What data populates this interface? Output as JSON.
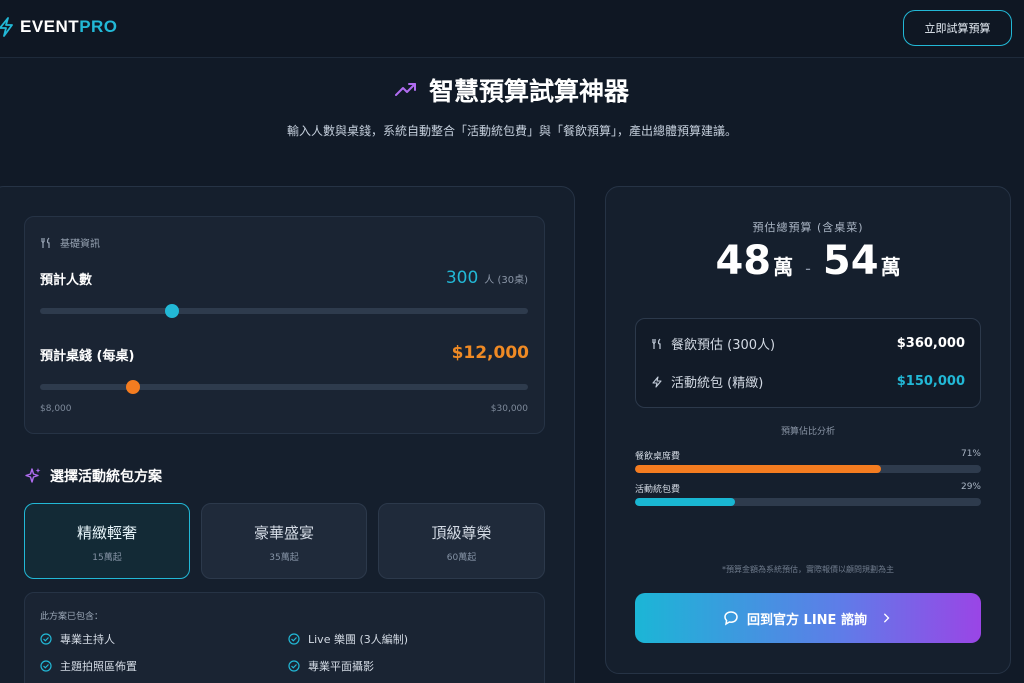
{
  "header": {
    "brand_a": "EVENT",
    "brand_b": "PRO",
    "cta": "立即試算預算"
  },
  "hero": {
    "title": "智慧預算試算神器",
    "subtitle": "輸入人數與桌錢，系統自動整合「活動統包費」與「餐飲預算」，產出總體預算建議。"
  },
  "basic": {
    "section_label": "基礎資訊",
    "people_label": "預計人數",
    "people_value": "300",
    "people_unit": "人 (30桌)",
    "people_slider_fraction": 0.27,
    "price_label": "預計桌錢 (每桌)",
    "price_value": "$12,000",
    "price_slider_fraction": 0.19,
    "price_min": "$8,000",
    "price_max": "$30,000"
  },
  "packages": {
    "heading": "選擇活動統包方案",
    "items": [
      {
        "name": "精緻輕奢",
        "sub": "15萬起",
        "active": true
      },
      {
        "name": "豪華盛宴",
        "sub": "35萬起",
        "active": false
      },
      {
        "name": "頂級尊榮",
        "sub": "60萬起",
        "active": false
      }
    ]
  },
  "includes": {
    "title": "此方案已包含：",
    "items": [
      "專業主持人",
      "Live 樂團 (3人編制)",
      "主題拍照區佈置",
      "專業平面攝影"
    ]
  },
  "estimate": {
    "label": "預估總預算 (含桌菜)",
    "low": "48",
    "high": "54",
    "unit": "萬",
    "dash": "-",
    "catering_label": "餐飲預估 (300人)",
    "catering_value": "$360,000",
    "package_label": "活動統包 (精緻)",
    "package_value": "$150,000",
    "ratio_title": "預算佔比分析",
    "bars": [
      {
        "label": "餐飲桌席費",
        "pct": "71%",
        "fraction": 0.71,
        "color": "#f47c20"
      },
      {
        "label": "活動統包費",
        "pct": "29%",
        "fraction": 0.29,
        "color": "#19b6d2"
      }
    ],
    "disclaimer": "*預算金額為系統預估，實際報價以顧問規劃為主",
    "line_button": "回到官方 LINE 諮詢"
  },
  "colors": {
    "accent_cyan": "#22b8d6",
    "accent_orange": "#f08a24",
    "green_text": "#2bd17a"
  }
}
